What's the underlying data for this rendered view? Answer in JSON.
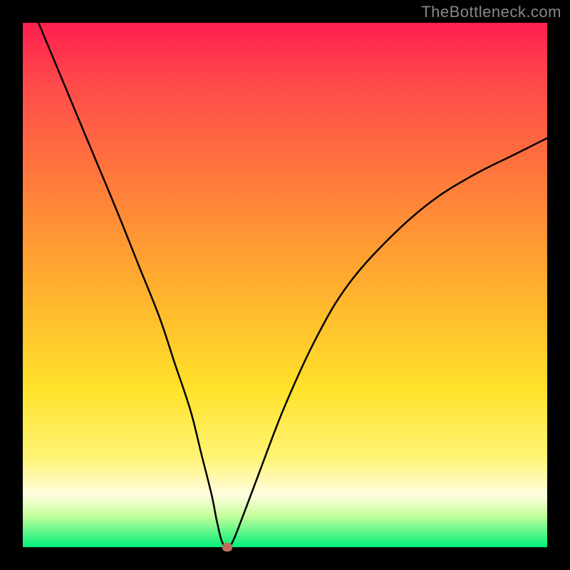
{
  "watermark": "TheBottleneck.com",
  "chart_data": {
    "type": "line",
    "title": "",
    "xlabel": "",
    "ylabel": "",
    "xlim": [
      0,
      100
    ],
    "ylim": [
      0,
      100
    ],
    "background_gradient": {
      "top_color": "#ff1f4f",
      "mid_top_color": "#ff7a3b",
      "mid_color": "#ffe22a",
      "mid_bottom_color": "#fffde0",
      "bottom_color": "#00f07a",
      "meaning": "red=high bottleneck, green=optimal"
    },
    "series": [
      {
        "name": "bottleneck-curve",
        "x": [
          3,
          8,
          13,
          18,
          22,
          26,
          29,
          32,
          34,
          36,
          37,
          38,
          39,
          40,
          42,
          45,
          50,
          56,
          62,
          70,
          78,
          86,
          94,
          100
        ],
        "values": [
          100,
          88,
          76,
          64,
          54,
          44,
          35,
          26,
          18,
          10,
          5,
          1,
          0,
          1,
          6,
          14,
          27,
          40,
          50,
          59,
          66,
          71,
          75,
          78
        ]
      }
    ],
    "marker": {
      "x": 39,
      "y": 0,
      "name": "optimal-point",
      "color": "#c06a5a"
    }
  }
}
